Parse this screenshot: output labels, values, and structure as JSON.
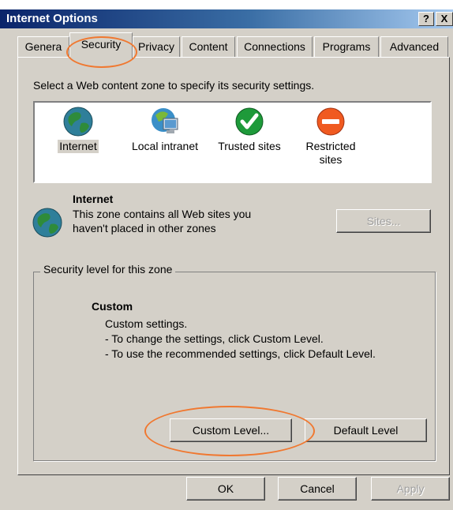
{
  "window": {
    "title": "Internet Options",
    "help_button": "?",
    "close_button": "X"
  },
  "tabs": [
    {
      "label": "General",
      "display": "Genera"
    },
    {
      "label": "Security"
    },
    {
      "label": "Privacy"
    },
    {
      "label": "Content"
    },
    {
      "label": "Connections"
    },
    {
      "label": "Programs"
    },
    {
      "label": "Advanced"
    }
  ],
  "security": {
    "instruction": "Select a Web content zone to specify its security settings.",
    "zones": [
      {
        "label": "Internet",
        "icon": "globe-icon",
        "selected": true
      },
      {
        "label": "Local intranet",
        "icon": "intranet-icon",
        "selected": false
      },
      {
        "label": "Trusted sites",
        "icon": "trusted-check-icon",
        "color": "#1e9a3a",
        "selected": false
      },
      {
        "label_line1": "Restricted",
        "label_line2": "sites",
        "icon": "restricted-icon",
        "color": "#f05a20",
        "selected": false
      }
    ],
    "zone_detail": {
      "title": "Internet",
      "desc_line1": "This zone contains all Web sites you",
      "desc_line2": "haven't placed in other zones",
      "sites_button": "Sites..."
    },
    "level": {
      "group_label": "Security level for this zone",
      "title": "Custom",
      "line1": "Custom settings.",
      "line2": "- To change the settings, click Custom Level.",
      "line3": "- To use the recommended settings, click Default Level.",
      "custom_button": "Custom Level...",
      "default_button": "Default Level"
    }
  },
  "footer": {
    "ok": "OK",
    "cancel": "Cancel",
    "apply": "Apply"
  },
  "colors": {
    "highlight_oval": "#f07830",
    "dialog_face": "#d4d0c8",
    "titlebar": "#0a246a"
  }
}
